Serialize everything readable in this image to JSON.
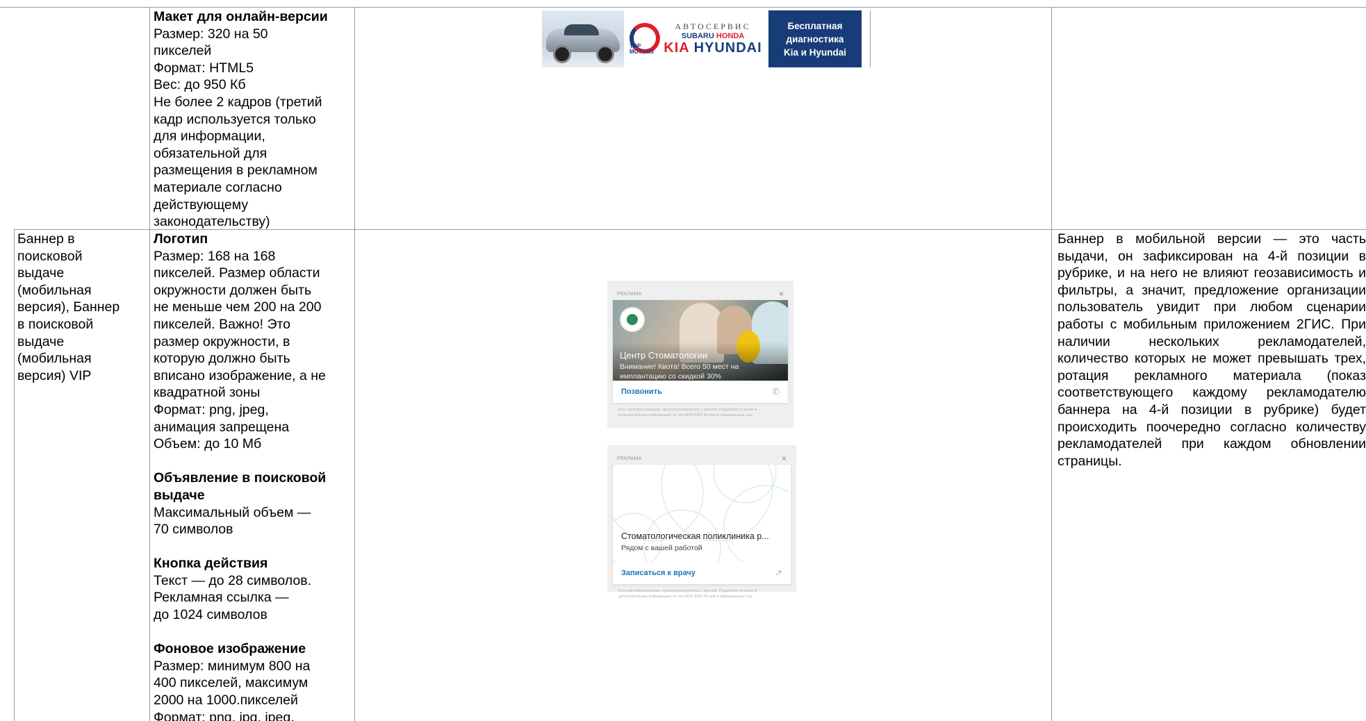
{
  "row1": {
    "col2": {
      "heading": "Макет для онлайн-версии",
      "lines": [
        "Размер: 320 на 50",
        "пикселей",
        "Формат: HTML5",
        "Вес: до 950 Кб",
        "Не более 2 кадров (третий",
        "кадр используется только",
        "для информации,",
        "обязательной для",
        "размещения в рекламном",
        "материале согласно",
        "действующему",
        "законодательству)"
      ]
    },
    "ad_banner": {
      "brand_line": "АВТОСЕРВИС",
      "makes_a": "SUBARU",
      "makes_b": "HONDA",
      "make_kia": "KIA",
      "make_hyundai": "HYUNDAI",
      "logo_text_1": "TOP",
      "logo_text_2": "MOTORS",
      "offer_1": "Бесплатная",
      "offer_2": "диагностика",
      "offer_3": "Kia и Hyundai",
      "accent_red": "#e31e2a",
      "accent_blue": "#173c78"
    }
  },
  "row2": {
    "col1": [
      "Баннер в",
      "поисковой",
      "выдаче",
      "(мобильная",
      "версия), Баннер",
      "в поисковой",
      "выдаче",
      "(мобильная",
      "версия) VIP"
    ],
    "col2": {
      "logo_heading": "Логотип",
      "logo_lines": [
        "Размер: 168 на 168",
        "пикселей. Размер области",
        "окружности должен быть",
        "не меньше чем 200 на 200",
        "пикселей. Важно! Это",
        "размер окружности, в",
        "которую должно быть",
        "вписано изображение, а не",
        "квадратной зоны",
        "Формат: png, jpeg,",
        "анимация запрещена",
        "Объем: до 10 Мб"
      ],
      "ad_heading_1": "Объявление в поисковой",
      "ad_heading_2": "выдаче",
      "ad_lines": [
        "Максимальный объем —",
        "70 символов"
      ],
      "button_heading": "Кнопка действия",
      "button_lines": [
        "Текст — до 28 символов.",
        "Рекламная ссылка —",
        "до 1024 символов"
      ],
      "bg_heading": "Фоновое изображение",
      "bg_lines": [
        "Размер: минимум 800 на",
        "400 пикселей, максимум",
        "2000 на 1000.пикселей",
        "Формат: png, jpg, jpeg,"
      ]
    },
    "card1": {
      "label": "РЕКЛАМА",
      "close": "×",
      "title": "Центр Стоматологии",
      "subtitle": "Внимание! Квота! Всего 50 мест на имплантацию со скидкой 30%",
      "action": "Позвонить",
      "action_icon": "phone-icon",
      "footnote": "Есть противопоказания, проконсультируйтесь с врачом. Подробности акции и дополнительная информация по тел 8029 8202 99 или в официальных соц."
    },
    "card2": {
      "label": "РЕКЛАМА",
      "close": "×",
      "title": "Стоматологическая поликлиника р...",
      "subtitle": "Рядом с вашей работой",
      "action": "Записаться к врачу",
      "action_icon": "external-link-icon",
      "footnote": "Есть противопоказания, проконсультируйтесь с врачом. Подробности акции и дополнительная информация по тел 8029 8202 99 или в официальных соц."
    },
    "col4_text": "Баннер в мобильной версии — это часть выдачи, он зафиксирован на 4-й позиции в рубрике, и на него не влияют геозависимость и фильтры, а значит, предложение организации пользователь увидит при любом сценарии работы с мобильным приложением 2ГИС. При наличии нескольких рекламодателей, количество которых не может превышать трех, ротация рекламного материала (показ соответствующего каждому рекламодателю баннера на 4-й позиции в рубрике) будет происходить поочередно согласно количеству рекламодателей при каждом обновлении страницы."
  },
  "colors": {
    "grid": "#9a9a9a",
    "link": "#1d74b8"
  }
}
